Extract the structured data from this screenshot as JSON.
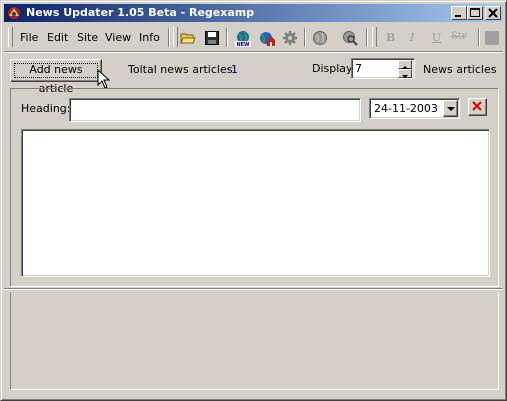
{
  "window": {
    "title": "News Updater 1.05 Beta - Regexamp"
  },
  "menu": {
    "items": [
      "File",
      "Edit",
      "Site",
      "View",
      "Info"
    ]
  },
  "toolbar": {
    "icons": [
      "open-folder-icon",
      "save-icon",
      "new-site-icon",
      "home-site-icon",
      "gear-icon",
      "globe-icon",
      "search-globe-icon"
    ],
    "format_labels": {
      "bold": "B",
      "italic": "I",
      "underline": "U",
      "strike": "Str"
    }
  },
  "news_bar": {
    "add_button_label": "Add news article",
    "total_label": "Toltal news articles:",
    "total_value": "1",
    "display_label": "Display",
    "display_value": "7",
    "display_suffix": "News articles"
  },
  "article": {
    "heading_label": "Heading:",
    "heading_value": "",
    "date_value": "24-11-2003",
    "body_text": ""
  },
  "colors": {
    "titlebar_start": "#0a246a",
    "titlebar_end": "#a6caf0",
    "face": "#d4d0c8",
    "count_blue": "#000080",
    "delete_red": "#e00000"
  }
}
